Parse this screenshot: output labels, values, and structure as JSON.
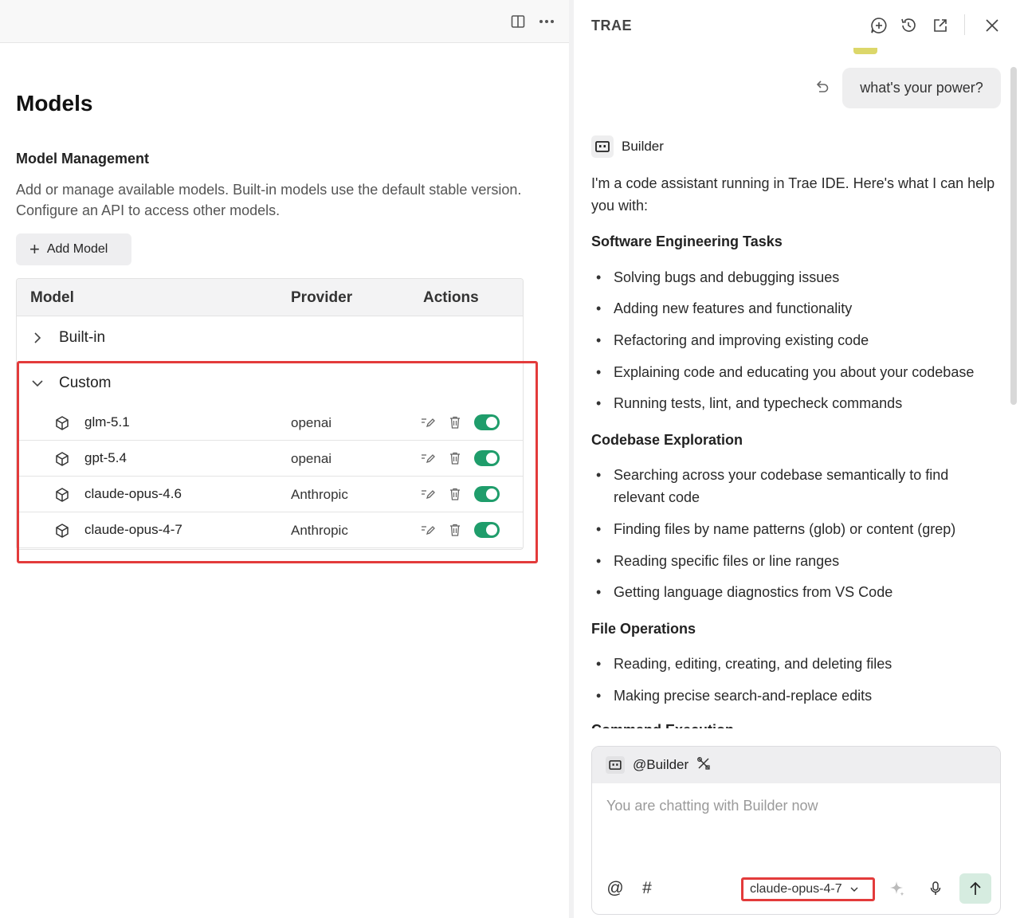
{
  "left": {
    "title": "Models",
    "section_title": "Model Management",
    "section_desc": "Add or manage available models. Built-in models use the default stable version. Configure an API to access other models.",
    "add_button": "Add Model",
    "table": {
      "headers": {
        "model": "Model",
        "provider": "Provider",
        "actions": "Actions"
      },
      "groups": [
        {
          "label": "Built-in",
          "expanded": false
        },
        {
          "label": "Custom",
          "expanded": true
        }
      ],
      "rows": [
        {
          "name": "glm-5.1",
          "provider": "openai",
          "enabled": true
        },
        {
          "name": "gpt-5.4",
          "provider": "openai",
          "enabled": true
        },
        {
          "name": "claude-opus-4.6",
          "provider": "Anthropic",
          "enabled": true
        },
        {
          "name": "claude-opus-4-7",
          "provider": "Anthropic",
          "enabled": true
        }
      ]
    }
  },
  "right": {
    "title": "TRAE",
    "user_message": "what's your power?",
    "agent_name": "Builder",
    "intro": "I'm a code assistant running in Trae IDE. Here's what I can help you with:",
    "sections": [
      {
        "heading": "Software Engineering Tasks",
        "items": [
          "Solving bugs and debugging issues",
          "Adding new features and functionality",
          "Refactoring and improving existing code",
          "Explaining code and educating you about your codebase",
          "Running tests, lint, and typecheck commands"
        ]
      },
      {
        "heading": "Codebase Exploration",
        "items": [
          "Searching across your codebase semantically to find relevant code",
          "Finding files by name patterns (glob) or content (grep)",
          "Reading specific files or line ranges",
          "Getting language diagnostics from VS Code"
        ]
      },
      {
        "heading": "File Operations",
        "items": [
          "Reading, editing, creating, and deleting files",
          "Making precise search-and-replace edits"
        ]
      },
      {
        "heading": "Command Execution",
        "items": []
      }
    ],
    "composer": {
      "agent_tag": "@Builder",
      "placeholder": "You are chatting with Builder now",
      "model": "claude-opus-4-7"
    }
  },
  "colors": {
    "toggle_on": "#1f9d6b",
    "highlight": "#e33b3b",
    "send_bg": "#d6ece0"
  }
}
